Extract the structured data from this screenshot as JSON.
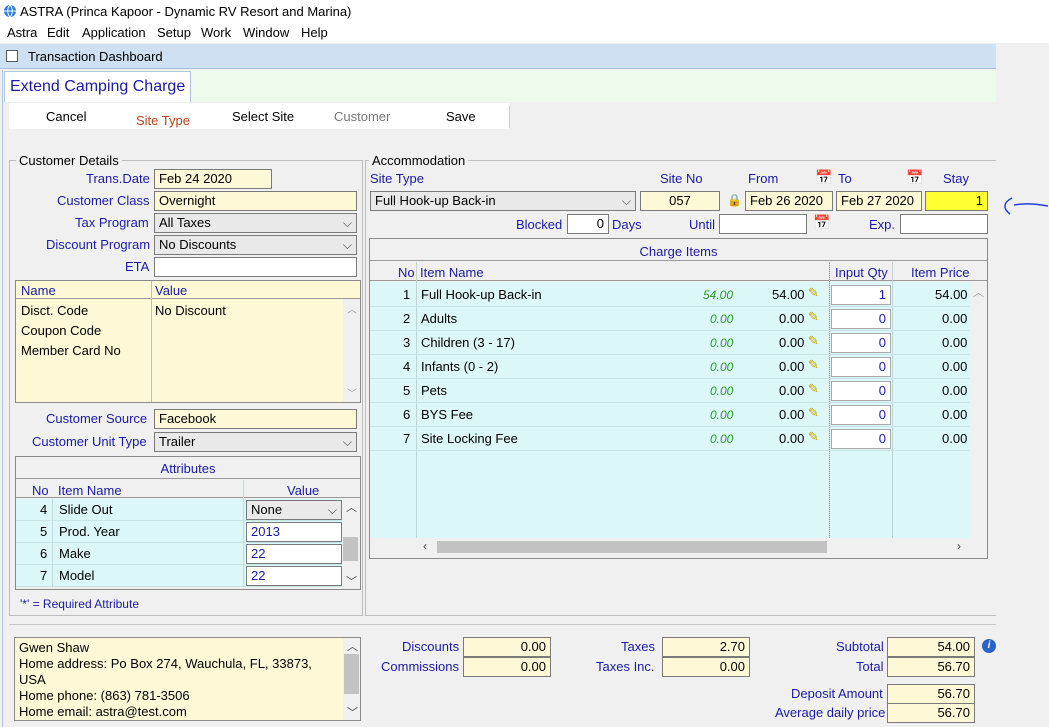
{
  "window": {
    "title": "ASTRA (Princa Kapoor - Dynamic RV Resort and Marina)"
  },
  "menu": [
    "Astra",
    "Edit",
    "Application",
    "Setup",
    "Work",
    "Window",
    "Help"
  ],
  "dashboard_tab": "Transaction Dashboard",
  "page_title": "Extend Camping Charge",
  "toolbar": {
    "cancel": "Cancel",
    "site_type": "Site Type",
    "select_site": "Select Site",
    "customer": "Customer",
    "save": "Save"
  },
  "customer_details": {
    "group_label": "Customer Details",
    "trans_date_label": "Trans.Date",
    "trans_date": "Feb 24 2020",
    "customer_class_label": "Customer Class",
    "customer_class": "Overnight",
    "tax_program_label": "Tax Program",
    "tax_program": "All Taxes",
    "discount_program_label": "Discount Program",
    "discount_program": "No Discounts",
    "eta_label": "ETA",
    "eta": "",
    "name_header": "Name",
    "value_header": "Value",
    "rows": [
      {
        "name": "Disct. Code",
        "value": "No Discount"
      },
      {
        "name": "Coupon Code",
        "value": ""
      },
      {
        "name": "Member Card No",
        "value": ""
      }
    ],
    "customer_source_label": "Customer Source",
    "customer_source": "Facebook",
    "customer_unit_type_label": "Customer Unit Type",
    "customer_unit_type": "Trailer"
  },
  "attributes": {
    "title": "Attributes",
    "headers": {
      "no": "No",
      "item": "Item Name",
      "value": "Value"
    },
    "rows": [
      {
        "no": "4",
        "item": "Slide Out",
        "value": "None"
      },
      {
        "no": "5",
        "item": "Prod. Year",
        "value": "2013"
      },
      {
        "no": "6",
        "item": "Make",
        "value": "22"
      },
      {
        "no": "7",
        "item": "Model",
        "value": "22"
      }
    ],
    "note": "'*' = Required Attribute"
  },
  "accommodation": {
    "group_label": "Accommodation",
    "site_type_label": "Site Type",
    "site_type": "Full Hook-up Back-in",
    "site_no_label": "Site No",
    "site_no": "057",
    "from_label": "From",
    "from": "Feb 26 2020",
    "to_label": "To",
    "to": "Feb 27 2020",
    "stay_label": "Stay",
    "stay": "1",
    "blocked_label": "Blocked",
    "blocked": "0",
    "days_label": "Days",
    "until_label": "Until",
    "until": "",
    "exp_label": "Exp.",
    "exp": ""
  },
  "charge_items": {
    "title": "Charge Items",
    "headers": {
      "no": "No",
      "item": "Item Name",
      "qty": "Input Qty",
      "price": "Item Price"
    },
    "rows": [
      {
        "no": "1",
        "item": "Full Hook-up Back-in",
        "rate": "54.00",
        "amount": "54.00",
        "qty": "1",
        "price": "54.00"
      },
      {
        "no": "2",
        "item": "Adults",
        "rate": "0.00",
        "amount": "0.00",
        "qty": "0",
        "price": "0.00"
      },
      {
        "no": "3",
        "item": "Children (3 - 17)",
        "rate": "0.00",
        "amount": "0.00",
        "qty": "0",
        "price": "0.00"
      },
      {
        "no": "4",
        "item": "Infants (0 - 2)",
        "rate": "0.00",
        "amount": "0.00",
        "qty": "0",
        "price": "0.00"
      },
      {
        "no": "5",
        "item": "Pets",
        "rate": "0.00",
        "amount": "0.00",
        "qty": "0",
        "price": "0.00"
      },
      {
        "no": "6",
        "item": "BYS Fee",
        "rate": "0.00",
        "amount": "0.00",
        "qty": "0",
        "price": "0.00"
      },
      {
        "no": "7",
        "item": "Site Locking Fee",
        "rate": "0.00",
        "amount": "0.00",
        "qty": "0",
        "price": "0.00"
      }
    ]
  },
  "customer_info": {
    "lines": [
      "Gwen Shaw",
      "Home address: Po Box 274, Wauchula, FL, 33873,",
      "USA",
      "Home phone: (863) 781-3506",
      "Home email: astra@test.com"
    ]
  },
  "totals": {
    "discounts_label": "Discounts",
    "discounts": "0.00",
    "commissions_label": "Commissions",
    "commissions": "0.00",
    "taxes_label": "Taxes",
    "taxes": "2.70",
    "taxes_inc_label": "Taxes Inc.",
    "taxes_inc": "0.00",
    "subtotal_label": "Subtotal",
    "subtotal": "54.00",
    "total_label": "Total",
    "total": "56.70",
    "deposit_label": "Deposit Amount",
    "deposit": "56.70",
    "avg_daily_label": "Average daily price",
    "avg_daily": "56.70"
  },
  "colors": {
    "label_blue": "#1a1aa6",
    "field_yellow": "#fdf9d6",
    "row_cyan": "#dcf7f7",
    "highlight": "#ffff33",
    "annotation": "#1f3fe0"
  }
}
